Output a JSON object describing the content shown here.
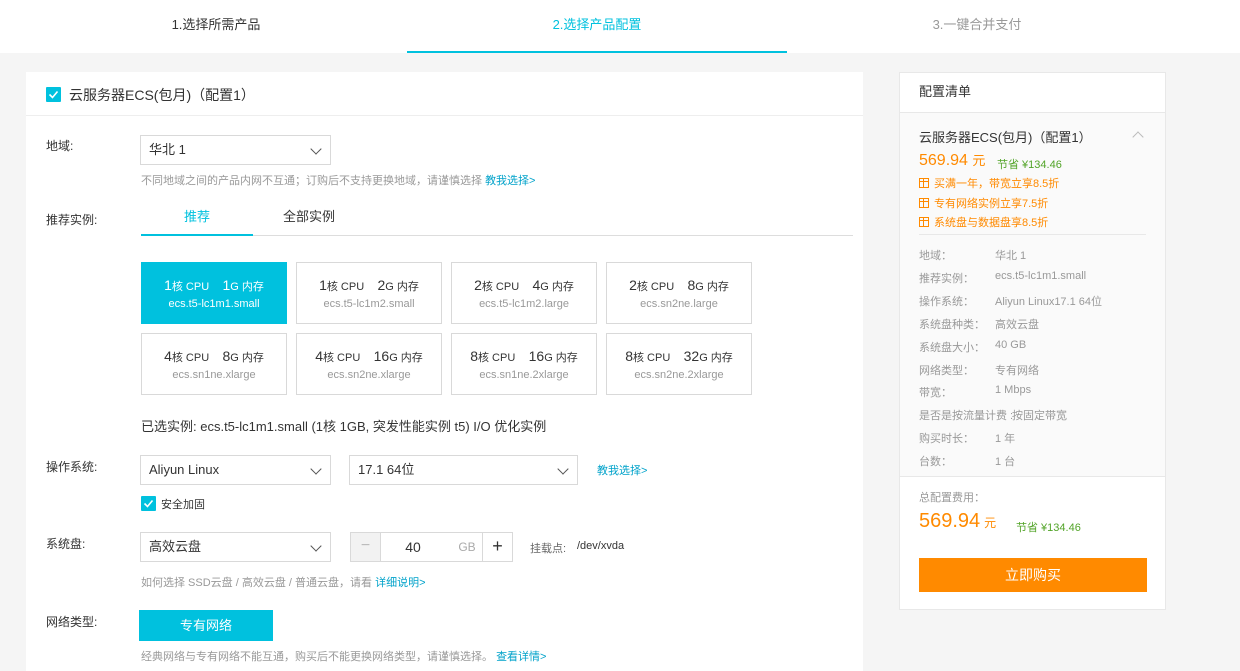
{
  "steps": [
    "1.选择所需产品",
    "2.选择产品配置",
    "3.一键合并支付"
  ],
  "main": {
    "title": "云服务器ECS(包月)（配置1）",
    "region": {
      "label": "地域:",
      "value": "华北 1",
      "hint": "不同地域之间的产品内网不互通；订购后不支持更换地域，请谨慎选择",
      "hint_link": "教我选择>"
    },
    "instance": {
      "label": "推荐实例:",
      "tabs": [
        "推荐",
        "全部实例"
      ],
      "cards": [
        {
          "cpu": "1",
          "cpu_unit": "核 CPU",
          "mem": "1",
          "mem_unit": "G 内存",
          "name": "ecs.t5-lc1m1.small",
          "selected": true
        },
        {
          "cpu": "1",
          "cpu_unit": "核 CPU",
          "mem": "2",
          "mem_unit": "G 内存",
          "name": "ecs.t5-lc1m2.small",
          "selected": false
        },
        {
          "cpu": "2",
          "cpu_unit": "核 CPU",
          "mem": "4",
          "mem_unit": "G 内存",
          "name": "ecs.t5-lc1m2.large",
          "selected": false
        },
        {
          "cpu": "2",
          "cpu_unit": "核 CPU",
          "mem": "8",
          "mem_unit": "G 内存",
          "name": "ecs.sn2ne.large",
          "selected": false
        },
        {
          "cpu": "4",
          "cpu_unit": "核 CPU",
          "mem": "8",
          "mem_unit": "G 内存",
          "name": "ecs.sn1ne.xlarge",
          "selected": false
        },
        {
          "cpu": "4",
          "cpu_unit": "核 CPU",
          "mem": "16",
          "mem_unit": "G 内存",
          "name": "ecs.sn2ne.xlarge",
          "selected": false
        },
        {
          "cpu": "8",
          "cpu_unit": "核 CPU",
          "mem": "16",
          "mem_unit": "G 内存",
          "name": "ecs.sn1ne.2xlarge",
          "selected": false
        },
        {
          "cpu": "8",
          "cpu_unit": "核 CPU",
          "mem": "32",
          "mem_unit": "G 内存",
          "name": "ecs.sn2ne.2xlarge",
          "selected": false
        }
      ],
      "selected_text": "已选实例: ecs.t5-lc1m1.small (1核 1GB, 突发性能实例 t5) I/O 优化实例"
    },
    "os": {
      "label": "操作系统:",
      "value": "Aliyun Linux",
      "version": "17.1 64位",
      "link": "教我选择>",
      "harden_label": "安全加固"
    },
    "disk": {
      "label": "系统盘:",
      "type": "高效云盘",
      "minus": "−",
      "size": "40",
      "unit": "GB",
      "plus": "+",
      "mount_label": "挂载点:",
      "mount_value": "/dev/xvda",
      "hint": "如何选择 SSD云盘 / 高效云盘 / 普通云盘，请看",
      "hint_link": "详细说明>"
    },
    "network": {
      "label": "网络类型:",
      "button": "专有网络",
      "hint": "经典网络与专有网络不能互通，购买后不能更换网络类型，请谨慎选择。",
      "hint_link": "查看详情>"
    }
  },
  "sidebar": {
    "header": "配置清单",
    "item_title": "云服务器ECS(包月)（配置1）",
    "price": "569.94",
    "price_unit": "元",
    "save": "节省 ¥134.46",
    "promos": [
      "买满一年，带宽立享8.5折",
      "专有网络实例立享7.5折",
      "系统盘与数据盘享8.5折"
    ],
    "details": [
      {
        "k": "地域：",
        "v": "华北 1"
      },
      {
        "k": "推荐实例：",
        "v": "ecs.t5-lc1m1.small"
      },
      {
        "k": "操作系统：",
        "v": "Aliyun Linux17.1 64位"
      },
      {
        "k": "系统盘种类：",
        "v": "高效云盘"
      },
      {
        "k": "系统盘大小：",
        "v": "40 GB"
      },
      {
        "k": "网络类型：",
        "v": "专有网络"
      },
      {
        "k": "带宽：",
        "v": "1 Mbps"
      },
      {
        "k": "是否是按流量计费 :",
        "v": "按固定带宽"
      },
      {
        "k": "购买时长：",
        "v": "1 年"
      },
      {
        "k": "台数：",
        "v": "1 台"
      }
    ],
    "total_label": "总配置费用：",
    "total_price": "569.94",
    "total_unit": "元",
    "total_save": "节省 ¥134.46",
    "buy_button": "立即购买"
  },
  "colors": {
    "accent": "#00c1de",
    "orange": "#ff8a00",
    "green": "#52a428"
  }
}
